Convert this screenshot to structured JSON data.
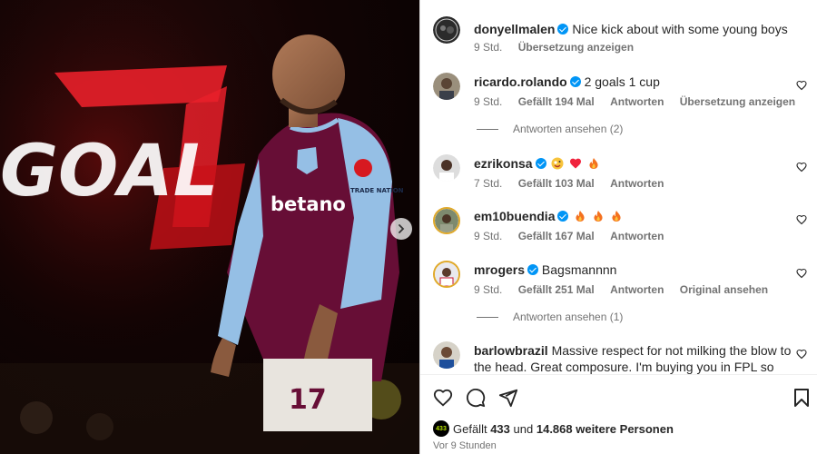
{
  "post": {
    "author": "donyellmalen",
    "caption": "Nice kick about with some young boys",
    "time": "9 Std.",
    "translate": "Übersetzung anzeigen"
  },
  "image": {
    "sign_text": "GOAL",
    "sponsor": "betano",
    "badge": "TRADE NATION",
    "shirt_number": "17"
  },
  "comments": [
    {
      "user": "ricardo.rolando",
      "text": "2 goals 1 cup",
      "time": "9 Std.",
      "likes": "Gefällt 194 Mal",
      "reply": "Antworten",
      "extra": "Übersetzung anzeigen",
      "view_replies": "Antworten ansehen (2)"
    },
    {
      "user": "ezrikonsa",
      "text": "",
      "time": "7 Std.",
      "likes": "Gefällt 103 Mal",
      "reply": "Antworten",
      "emojis": [
        "crazy-face-emoji",
        "heart-emoji",
        "fire-emoji"
      ]
    },
    {
      "user": "em10buendia",
      "text": "",
      "time": "9 Std.",
      "likes": "Gefällt 167 Mal",
      "reply": "Antworten",
      "emojis": [
        "fire-emoji",
        "fire-emoji",
        "fire-emoji"
      ]
    },
    {
      "user": "mrogers",
      "text": "Bagsmannnn",
      "time": "9 Std.",
      "likes": "Gefällt 251 Mal",
      "reply": "Antworten",
      "extra": "Original ansehen",
      "view_replies": "Antworten ansehen (1)"
    },
    {
      "user": "barlowbrazil",
      "text": "Massive respect for not milking the blow to the head. Great composure. I'm buying you in FPL so please make sure you get Cornley"
    }
  ],
  "likes_line": {
    "prefix": "Gefällt",
    "count": "433",
    "mid": "und",
    "others": "14.868 weitere Personen",
    "mini_label": "433"
  },
  "time_ago": "Vor 9 Stunden",
  "icons": [
    "heart-icon",
    "comment-icon",
    "share-icon",
    "bookmark-icon",
    "chevron-right-icon",
    "verified-icon"
  ],
  "colors": {
    "verified": "#0095f6",
    "meta": "#737373",
    "text": "#262626",
    "villa_claret": "#670e36",
    "villa_blue": "#95bfe5"
  }
}
